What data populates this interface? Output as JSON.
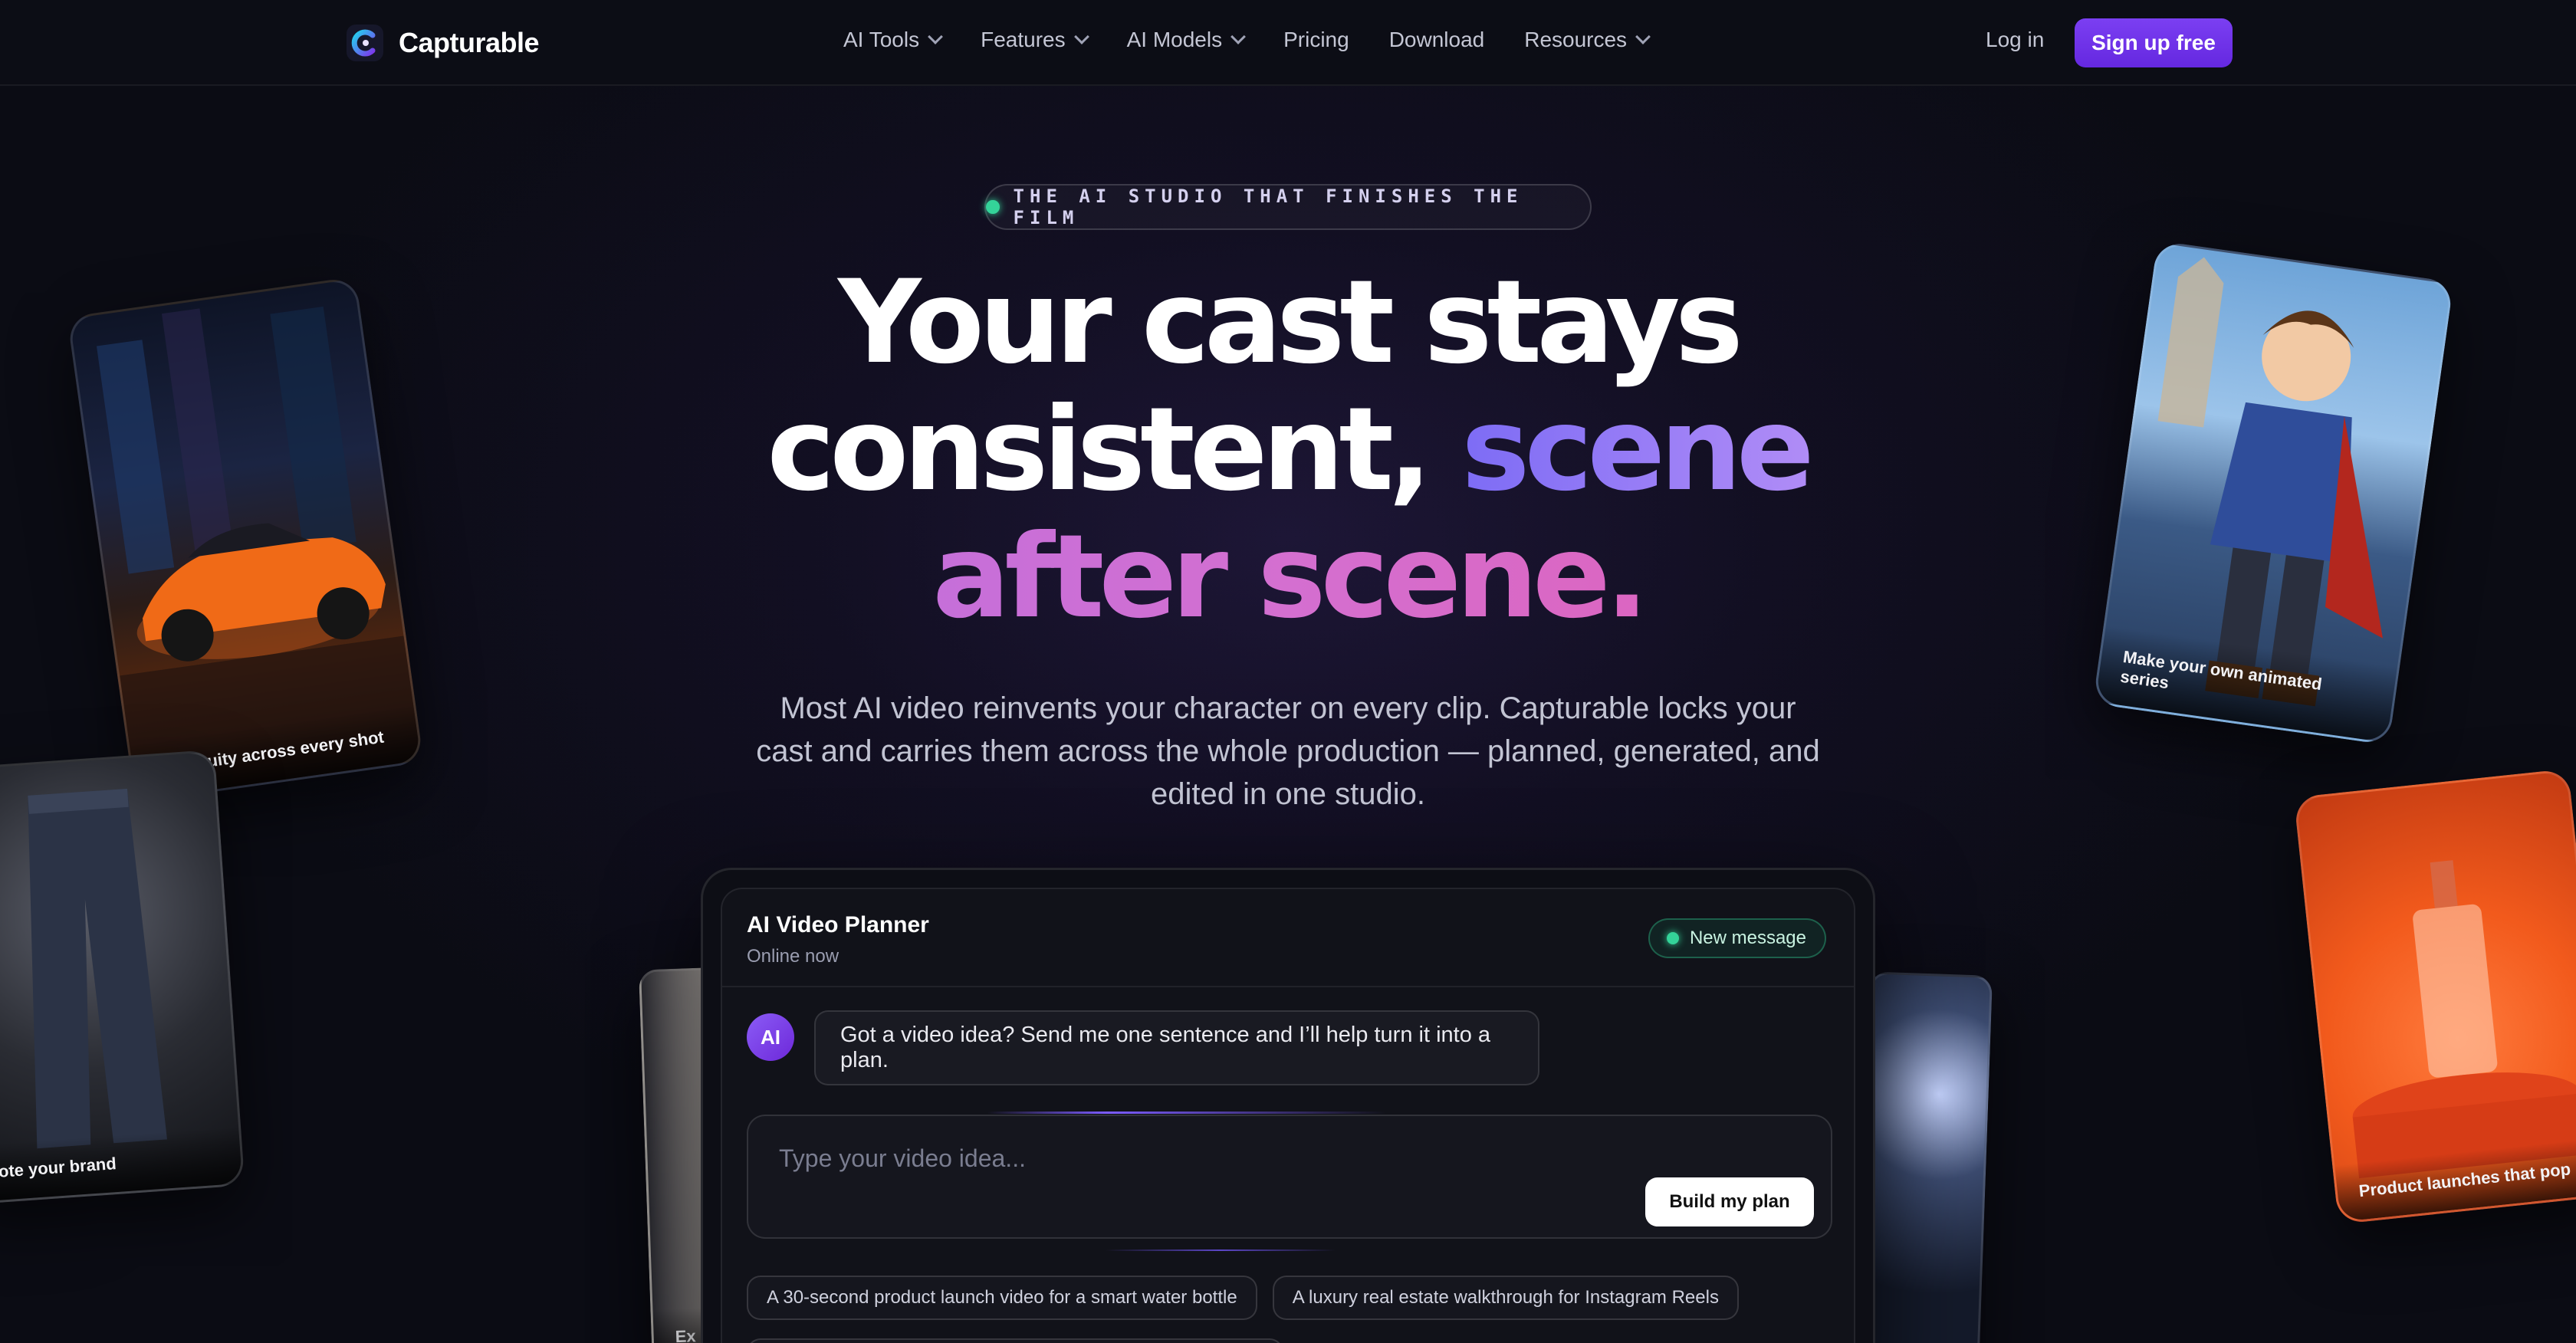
{
  "brand": {
    "name": "Capturable"
  },
  "nav": {
    "items": [
      {
        "label": "AI Tools",
        "dropdown": true
      },
      {
        "label": "Features",
        "dropdown": true
      },
      {
        "label": "AI Models",
        "dropdown": true
      },
      {
        "label": "Pricing",
        "dropdown": false
      },
      {
        "label": "Download",
        "dropdown": false
      },
      {
        "label": "Resources",
        "dropdown": true
      }
    ],
    "login": "Log in",
    "signup": "Sign up free"
  },
  "hero": {
    "eyebrow": "THE AI STUDIO THAT FINISHES THE FILM",
    "headline_line1": "Your cast stays",
    "headline_line2_plain": "consistent, ",
    "headline_line2_accent": "scene",
    "headline_line3": "after scene.",
    "subtitle": "Most AI video reinvents your character on every clip. Capturable locks your cast and carries them across the whole production — planned, generated, and edited in one studio."
  },
  "cards": {
    "car": "Continuity across every shot",
    "hero": "Make your own animated series",
    "jeans": "mote your brand",
    "perfume": "Product launches that pop",
    "back_left": "Ex"
  },
  "planner": {
    "title": "AI Video Planner",
    "status": "Online now",
    "badge": "New message",
    "avatar": "AI",
    "message": "Got a video idea? Send me one sentence and I’ll help turn it into a plan.",
    "input_placeholder": "Type your video idea...",
    "build_button": "Build my plan",
    "suggestions": [
      "A 30-second product launch video for a smart water bottle",
      "A luxury real estate walkthrough for Instagram Reels"
    ]
  },
  "colors": {
    "accent": "#6d2ee6",
    "online": "#34d399",
    "background": "#0b0c14"
  }
}
